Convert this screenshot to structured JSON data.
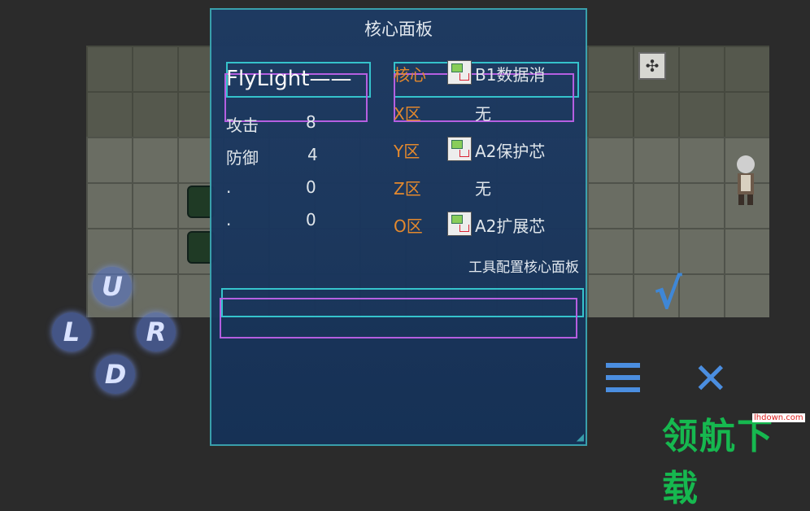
{
  "panel": {
    "title": "核心面板",
    "hero_name": "FlyLight——",
    "stats": [
      {
        "label": "攻击",
        "value": "8"
      },
      {
        "label": "防御",
        "value": "4"
      },
      {
        "label": ".",
        "value": "0"
      },
      {
        "label": ".",
        "value": "0"
      }
    ],
    "slots": [
      {
        "label": "核心",
        "item": "B1数据消",
        "icon": "chip-icon"
      },
      {
        "label": "X区",
        "item": "无",
        "icon": ""
      },
      {
        "label": "Y区",
        "item": "A2保护芯",
        "icon": "chip-icon"
      },
      {
        "label": "Z区",
        "item": "无",
        "icon": ""
      },
      {
        "label": "O区",
        "item": "A2扩展芯",
        "icon": "chip-icon"
      }
    ],
    "tool_title": "工具配置核心面板"
  },
  "controls": {
    "up": "U",
    "left": "L",
    "right": "R",
    "down": "D",
    "confirm": "√",
    "close": "✕"
  },
  "watermark": {
    "text": "领航下载",
    "url": "lhdown.com"
  },
  "colors": {
    "panel_bg": "#163257",
    "cyan_border": "#34c6d0",
    "purple_border": "#b960e6",
    "slot_label": "#e88a2c",
    "button_blue": "#4b8ee0"
  }
}
